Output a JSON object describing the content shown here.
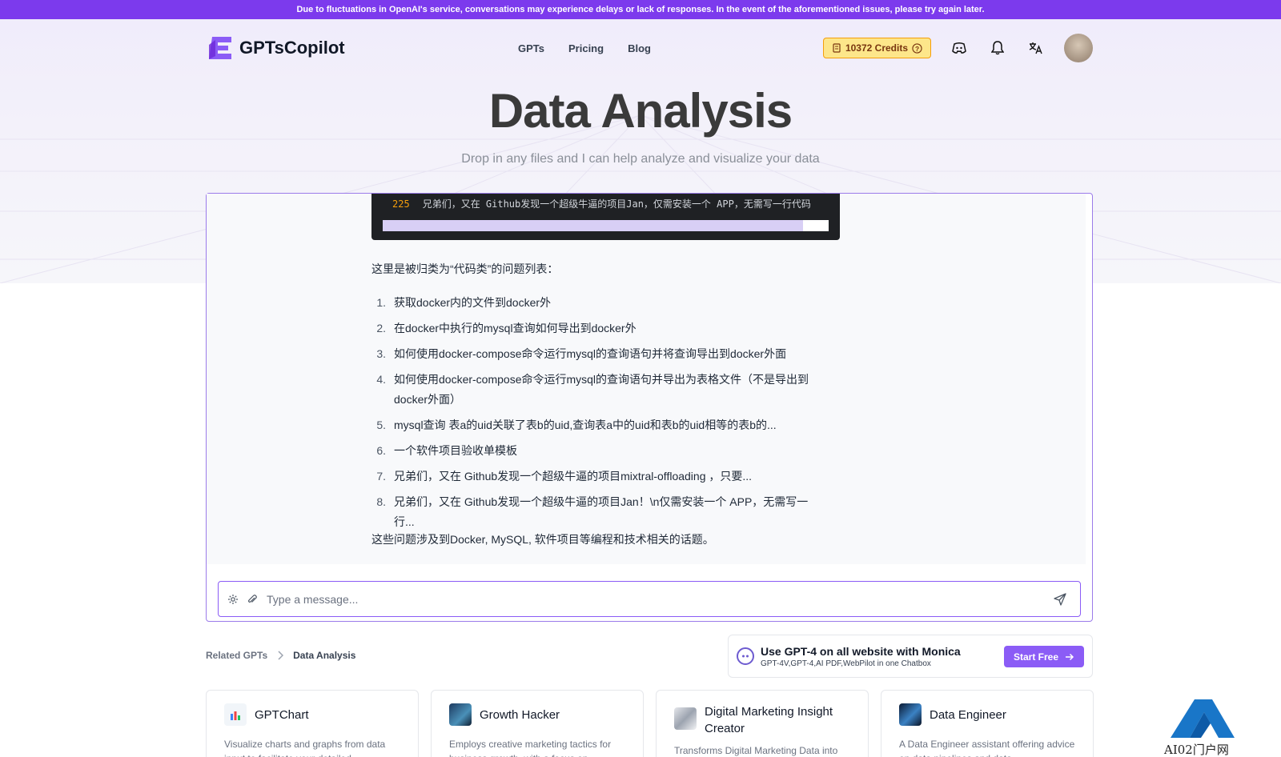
{
  "banner": {
    "text": "Due to fluctuations in OpenAI's service, conversations may experience delays or lack of responses. In the event of the aforementioned issues, please try again later."
  },
  "nav": {
    "brand": "GPTsCopilot",
    "links": [
      "GPTs",
      "Pricing",
      "Blog"
    ],
    "credits": "10372 Credits"
  },
  "hero": {
    "title": "Data Analysis",
    "subtitle": "Drop in any files and I can help analyze and visualize your data"
  },
  "chat": {
    "code_line_number": "225",
    "code_line_text": "兄弟们，又在 Github发现一个超级牛逼的项目Jan，仅需安装一个 APP，无需写一行代码",
    "intro": "这里是被归类为“代码类”的问题列表：",
    "items": [
      "获取docker内的文件到docker外",
      "在docker中执行的mysql查询如何导出到docker外",
      "如何使用docker-compose命令运行mysql的查询语句并将查询导出到docker外面",
      "如何使用docker-compose命令运行mysql的查询语句并导出为表格文件（不是导出到docker外面）",
      "mysql查询 表a的uid关联了表b的uid,查询表a中的uid和表b的uid相等的表b的...",
      "一个软件项目验收单模板",
      "兄弟们，又在 Github发现一个超级牛逼的项目mixtral-offloading ，只要...",
      "兄弟们，又在 Github发现一个超级牛逼的项目Jan！\\n仅需安装一个 APP，无需写一行..."
    ],
    "outro": "这些问题涉及到Docker, MySQL, 软件项目等编程和技术相关的话题。",
    "input_placeholder": "Type a message...",
    "input_value": ""
  },
  "breadcrumb": {
    "parent": "Related GPTs",
    "current": "Data Analysis"
  },
  "promo": {
    "title": "Use GPT-4 on all website with Monica",
    "subtitle": "GPT-4V,GPT-4,AI PDF,WebPilot in one Chatbox",
    "button": "Start Free"
  },
  "related": [
    {
      "name": "GPTChart",
      "desc": "Visualize charts and graphs from data input to facilitate your detailed",
      "icon": "chart-icon"
    },
    {
      "name": "Growth Hacker",
      "desc": "Employs creative marketing tactics for business growth, with a focus on",
      "icon": "growth-icon"
    },
    {
      "name": "Digital Marketing Insight Creator",
      "desc": "Transforms Digital Marketing Data into",
      "icon": "marketing-icon"
    },
    {
      "name": "Data Engineer",
      "desc": "A Data Engineer assistant offering advice on data pipelines and data",
      "icon": "data-engineer-icon"
    }
  ],
  "watermark": {
    "text": "AI02门户网"
  },
  "colors": {
    "accent": "#8b5cf6",
    "banner": "#7c3aed",
    "credits_bg": "#fde68a"
  }
}
